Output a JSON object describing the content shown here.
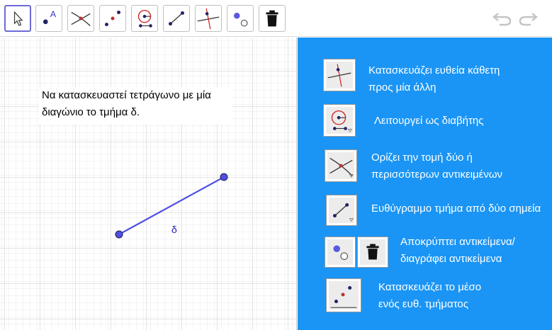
{
  "toolbar": {
    "tools": [
      {
        "name": "move-tool",
        "icon": "arrow-cursor-icon",
        "active": true
      },
      {
        "name": "point-tool",
        "icon": "point-with-label-icon",
        "label": "A"
      },
      {
        "name": "intersect-tool",
        "icon": "intersect-icon"
      },
      {
        "name": "midpoint-tool",
        "icon": "midpoint-icon"
      },
      {
        "name": "compass-tool",
        "icon": "compass-icon"
      },
      {
        "name": "segment-tool",
        "icon": "segment-icon"
      },
      {
        "name": "perpendicular-tool",
        "icon": "perpendicular-line-icon"
      },
      {
        "name": "show-hide-tool",
        "icon": "show-hide-object-icon"
      },
      {
        "name": "delete-tool",
        "icon": "trash-icon"
      }
    ],
    "undo_icon": "undo-icon",
    "redo_icon": "redo-icon"
  },
  "graphics": {
    "task_line1": "Να κατασκευαστεί τετράγωνο με μία",
    "task_line2": "διαγώνιο το τμήμα δ.",
    "segment_label": "δ",
    "point_color": "#4f4fe8",
    "segment_color": "#4f4fe8"
  },
  "panel": {
    "background": "#1a95f5",
    "rows": [
      {
        "icon": "perpendicular-line-icon",
        "line1": "Κατασκευάζει ευθεία κάθετη",
        "line2": "προς μία άλλη"
      },
      {
        "icon": "compass-icon",
        "line1": "Λειτουργεί ως διαβήτης",
        "line2": ""
      },
      {
        "icon": "intersect-icon",
        "line1": "Ορίζει την τομή δύο ή",
        "line2": "περισσότερων αντικειμένων"
      },
      {
        "icon": "segment-icon",
        "line1": "Ευθύγραμμο τμήμα από δύο σημεία",
        "line2": ""
      },
      {
        "icon": "show-hide-object-icon",
        "icon2": "trash-icon",
        "line1": "Αποκρύπτει αντικείμενα/",
        "line2": "διαγράφει αντικείμενα"
      },
      {
        "icon": "midpoint-icon",
        "line1": "Κατασκευάζει το μέσο",
        "line2": "ενός ευθ. τμήματος"
      }
    ]
  }
}
